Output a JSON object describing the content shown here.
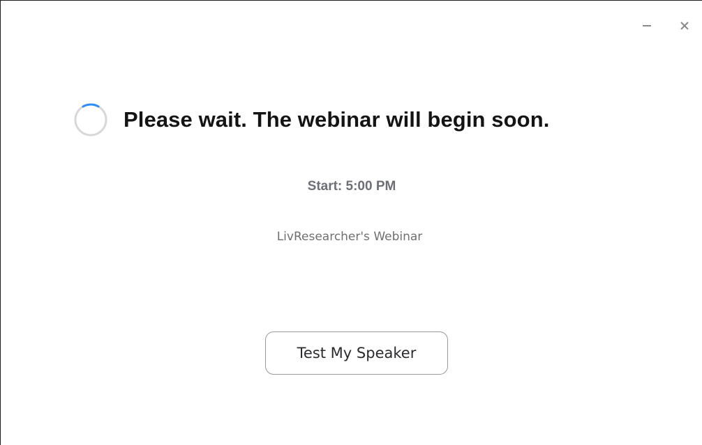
{
  "window": {
    "minimize_icon": "minimize-icon",
    "close_icon": "close-icon"
  },
  "status": {
    "spinner_icon": "loading-spinner-icon",
    "message": "Please wait. The webinar will begin soon.",
    "start_time": "Start: 5:00 PM",
    "webinar_name": "LivResearcher's Webinar"
  },
  "actions": {
    "test_speaker_label": "Test My Speaker"
  },
  "colors": {
    "spinner_track": "#d8d8d8",
    "spinner_arc": "#2d8cff",
    "title_text": "#141414",
    "muted_text": "#6d6f77",
    "button_border": "#9a9a9a"
  }
}
